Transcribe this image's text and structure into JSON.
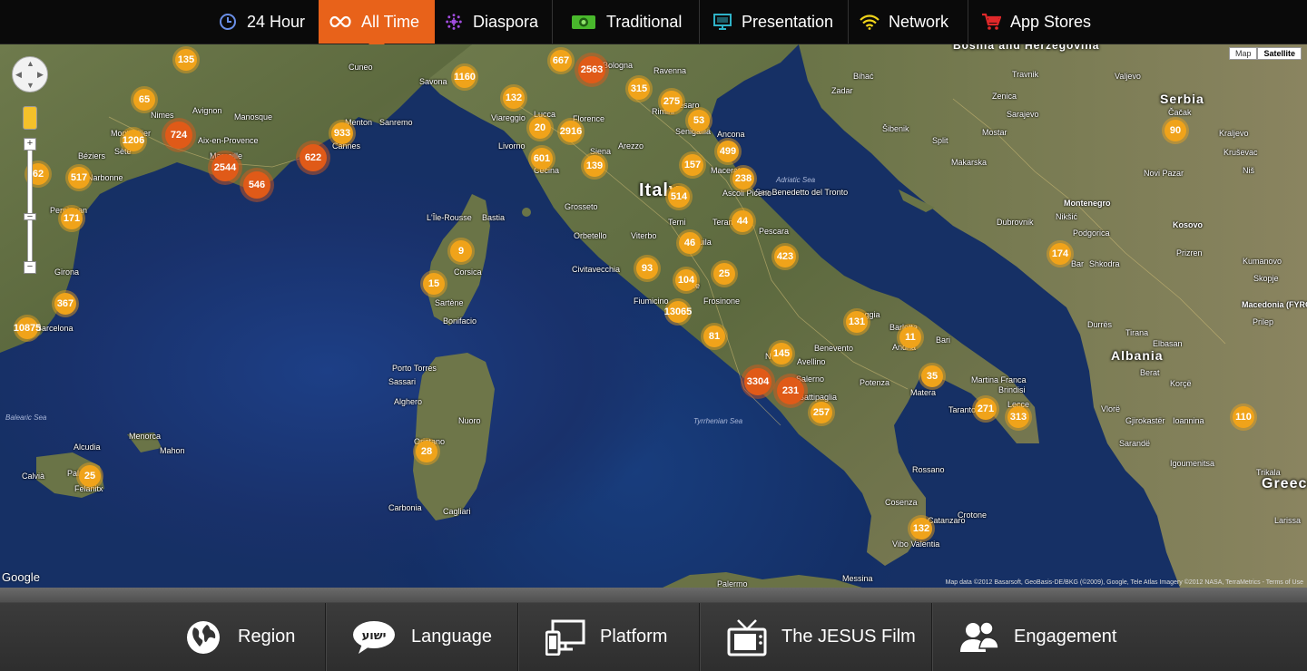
{
  "top_nav": {
    "tabs": [
      {
        "label": "24 Hour",
        "icon": "clock-icon",
        "active": false
      },
      {
        "label": "All Time",
        "icon": "infinity-icon",
        "active": true
      },
      {
        "label": "Diaspora",
        "icon": "burst-icon",
        "active": false
      },
      {
        "label": "Traditional",
        "icon": "projector-icon",
        "active": false
      },
      {
        "label": "Presentation",
        "icon": "monitor-icon",
        "active": false
      },
      {
        "label": "Network",
        "icon": "wifi-icon",
        "active": false
      },
      {
        "label": "App Stores",
        "icon": "cart-icon",
        "active": false
      }
    ],
    "colors": {
      "active": "#e8621a",
      "bar": "#0a0a0a"
    }
  },
  "map": {
    "type_buttons": {
      "map": "Map",
      "satellite": "Satellite",
      "selected": "Satellite"
    },
    "google_logo": "Google",
    "attribution": "Map data ©2012 Basarsoft, GeoBasis-DE/BKG (©2009), Google, Tele Atlas Imagery ©2012 NASA, TerraMetrics - Terms of Use",
    "countries": [
      "Italy",
      "Serbia",
      "Albania",
      "Montenegro",
      "Kosovo",
      "Bosnia and Herzegovina",
      "Macedonia (FYROM)",
      "Greece"
    ],
    "seas": [
      "Balearic Sea",
      "Tyrrhenian Sea",
      "Adriatic Sea"
    ],
    "places": [
      "Cuneo",
      "Savona",
      "Bologna",
      "Ravenna",
      "Nimes",
      "Avignon",
      "Manosque",
      "Montpellier",
      "Aix-en-Provence",
      "Marseille",
      "Cannes",
      "Menton",
      "Sanremo",
      "Viareggio",
      "Lucca",
      "Florence",
      "Livorno",
      "Cecina",
      "Arezzo",
      "Siena",
      "Grosseto",
      "Orbetello",
      "Terni",
      "Viterbo",
      "L'Aquila",
      "Pescara",
      "Teramo",
      "Civitavecchia",
      "Rome",
      "Fiumicino",
      "Frosinone",
      "Naples",
      "Avellino",
      "Salerno",
      "Benevento",
      "Foggia",
      "Barletta",
      "Andria",
      "Bari",
      "Matera",
      "Potenza",
      "Taranto",
      "Brindisi",
      "Lecce",
      "Martina Franca",
      "Battipaglia",
      "Cosenza",
      "Crotone",
      "Catanzaro",
      "Vibo Valentia",
      "Messina",
      "Palermo",
      "Rossano",
      "Bastia",
      "L'Île-Rousse",
      "Corsica",
      "Sartène",
      "Bonifacio",
      "Porto Torres",
      "Sassari",
      "Alghero",
      "Nuoro",
      "Oristano",
      "Cagliari",
      "Carbonia",
      "Menorca",
      "Mahon",
      "Alcudia",
      "Palma",
      "Felanitx",
      "Calvià",
      "Girona",
      "Barcelona",
      "Perpignan",
      "Narbonne",
      "Béziers",
      "Sète",
      "Ancona",
      "Rimini",
      "Pesaro",
      "Senigallia",
      "Macerata",
      "San Benedetto del Tronto",
      "Ascoli Piceno",
      "Split",
      "Šibenik",
      "Zadar",
      "Dubrovnik",
      "Makarska",
      "Mostar",
      "Sarajevo",
      "Zenica",
      "Podgorica",
      "Nikšić",
      "Bar",
      "Shkodra",
      "Tirana",
      "Durrës",
      "Vlorë",
      "Sarandë",
      "Gjirokastër",
      "Korçë",
      "Berat",
      "Elbasan",
      "Prizren",
      "Skopje",
      "Prilep",
      "Kumanovo",
      "Kraljevo",
      "Niš",
      "Čačak",
      "Kruševac",
      "Ioannina",
      "Trikala",
      "Igoumenitsa",
      "Larissa",
      "Novi Pazar",
      "Valjevo",
      "Travnik",
      "Bihać"
    ],
    "markers": [
      {
        "v": "135"
      },
      {
        "v": "65"
      },
      {
        "v": "1206"
      },
      {
        "v": "724"
      },
      {
        "v": "2544"
      },
      {
        "v": "546"
      },
      {
        "v": "622"
      },
      {
        "v": "933"
      },
      {
        "v": "62"
      },
      {
        "v": "517"
      },
      {
        "v": "171"
      },
      {
        "v": "367"
      },
      {
        "v": "10875"
      },
      {
        "v": "1160"
      },
      {
        "v": "132"
      },
      {
        "v": "667"
      },
      {
        "v": "2563"
      },
      {
        "v": "315"
      },
      {
        "v": "275"
      },
      {
        "v": "53"
      },
      {
        "v": "20"
      },
      {
        "v": "2916"
      },
      {
        "v": "601"
      },
      {
        "v": "139"
      },
      {
        "v": "499"
      },
      {
        "v": "157"
      },
      {
        "v": "238"
      },
      {
        "v": "514"
      },
      {
        "v": "44"
      },
      {
        "v": "46"
      },
      {
        "v": "423"
      },
      {
        "v": "93"
      },
      {
        "v": "25"
      },
      {
        "v": "104"
      },
      {
        "v": "13065"
      },
      {
        "v": "81"
      },
      {
        "v": "145"
      },
      {
        "v": "3304"
      },
      {
        "v": "231"
      },
      {
        "v": "257"
      },
      {
        "v": "131"
      },
      {
        "v": "11"
      },
      {
        "v": "35"
      },
      {
        "v": "271"
      },
      {
        "v": "313"
      },
      {
        "v": "132"
      },
      {
        "v": "9"
      },
      {
        "v": "15"
      },
      {
        "v": "28"
      },
      {
        "v": "25"
      },
      {
        "v": "174"
      },
      {
        "v": "90"
      },
      {
        "v": "110"
      }
    ]
  },
  "bottom_nav": {
    "tabs": [
      {
        "label": "Region",
        "icon": "globe-icon"
      },
      {
        "label": "Language",
        "icon": "speech-bubble-icon",
        "icon_text": "ישוע"
      },
      {
        "label": "Platform",
        "icon": "devices-icon"
      },
      {
        "label": "The JESUS Film",
        "icon": "tv-icon"
      },
      {
        "label": "Engagement",
        "icon": "people-icon"
      }
    ]
  }
}
